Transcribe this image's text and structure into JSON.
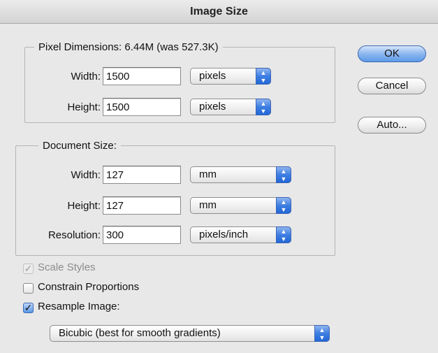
{
  "window": {
    "title": "Image Size"
  },
  "pixel_dimensions": {
    "legend": "Pixel Dimensions:  6.44M (was 527.3K)",
    "width_label": "Width:",
    "width_value": "1500",
    "width_unit": "pixels",
    "height_label": "Height:",
    "height_value": "1500",
    "height_unit": "pixels"
  },
  "document_size": {
    "legend": "Document Size:",
    "width_label": "Width:",
    "width_value": "127",
    "width_unit": "mm",
    "height_label": "Height:",
    "height_value": "127",
    "height_unit": "mm",
    "resolution_label": "Resolution:",
    "resolution_value": "300",
    "resolution_unit": "pixels/inch"
  },
  "options": {
    "scale_styles": {
      "label": "Scale Styles",
      "checked": true,
      "enabled": false
    },
    "constrain_proportions": {
      "label": "Constrain Proportions",
      "checked": false
    },
    "resample_image": {
      "label": "Resample Image:",
      "checked": true
    },
    "resample_method": "Bicubic (best for smooth gradients)"
  },
  "buttons": {
    "ok": "OK",
    "cancel": "Cancel",
    "auto": "Auto..."
  },
  "colors": {
    "accent": "#5d9ae8",
    "background": "#e8e8e8"
  }
}
